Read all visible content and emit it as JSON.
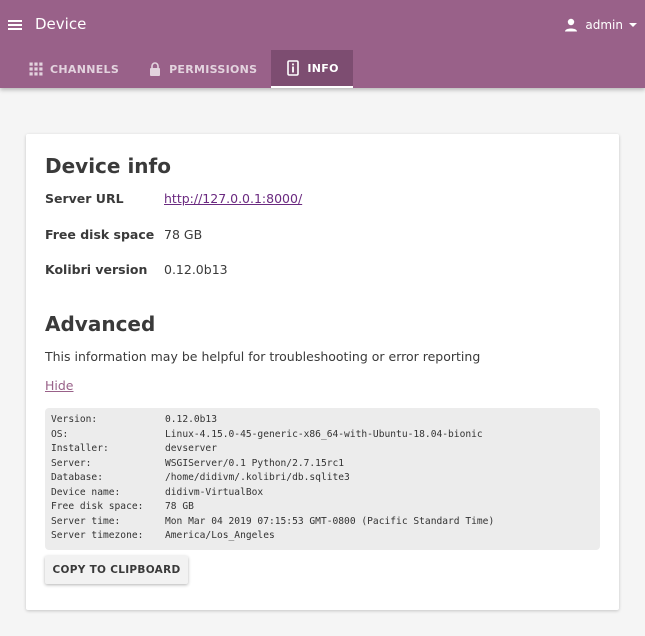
{
  "header": {
    "title": "Device",
    "user": {
      "name": "admin"
    }
  },
  "colors": {
    "brand": "#996189",
    "active_tab": "#7d4d71",
    "link": "#6b2a80"
  },
  "icons": {
    "menu": "hamburger-menu-icon",
    "user": "person-icon",
    "user_caret": "caret-down-icon",
    "channels": "apps-grid-icon",
    "permissions": "lock-icon",
    "info": "info-icon"
  },
  "tabs": [
    {
      "label": "CHANNELS",
      "active": false
    },
    {
      "label": "PERMISSIONS",
      "active": false
    },
    {
      "label": "INFO",
      "active": true
    }
  ],
  "device_info": {
    "heading": "Device info",
    "rows": [
      {
        "label": "Server URL",
        "value": "http://127.0.0.1:8000/"
      },
      {
        "label": "Free disk space",
        "value": "78 GB"
      },
      {
        "label": "Kolibri version",
        "value": "0.12.0b13"
      }
    ]
  },
  "advanced": {
    "heading": "Advanced",
    "description": "This information may be helpful for troubleshooting or error reporting",
    "hide_label": "Hide",
    "debug_rows": [
      {
        "key": "Version:",
        "value": "0.12.0b13"
      },
      {
        "key": "OS:",
        "value": "Linux-4.15.0-45-generic-x86_64-with-Ubuntu-18.04-bionic"
      },
      {
        "key": "Installer:",
        "value": "devserver"
      },
      {
        "key": "Server:",
        "value": "WSGIServer/0.1 Python/2.7.15rc1"
      },
      {
        "key": "Database:",
        "value": "/home/didivm/.kolibri/db.sqlite3"
      },
      {
        "key": "Device name:",
        "value": "didivm-VirtualBox"
      },
      {
        "key": "Free disk space:",
        "value": "78 GB"
      },
      {
        "key": "Server time:",
        "value": "Mon Mar 04 2019 07:15:53 GMT-0800 (Pacific Standard Time)"
      },
      {
        "key": "Server timezone:",
        "value": "America/Los_Angeles"
      }
    ],
    "copy_label": "COPY TO CLIPBOARD"
  }
}
